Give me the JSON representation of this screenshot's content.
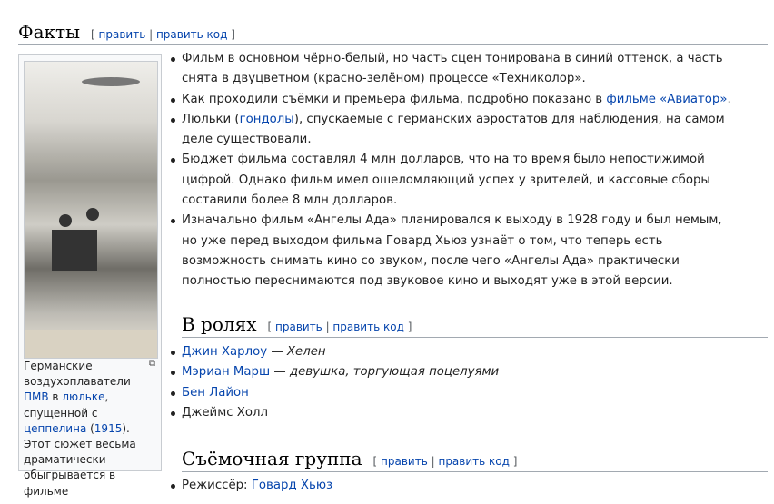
{
  "edit": {
    "edit": "править",
    "edit_code": "править код"
  },
  "facts": {
    "title": "Факты",
    "items": [
      {
        "text": "Фильм в основном чёрно-белый, но часть сцен тонирована в синий оттенок, а часть снята в двуцветном (красно-зелёном) процессе «Техниколор»."
      },
      {
        "pre": "Как проходили съёмки и премьера фильма, подробно показано в ",
        "link": "фильме «Авиатор»",
        "post": "."
      },
      {
        "pre": "Люльки (",
        "link": "гондолы",
        "post": "), спускаемые с германских аэростатов для наблюдения, на самом деле существовали."
      },
      {
        "text": "Бюджет фильма составлял 4 млн долларов, что на то время было непостижимой цифрой. Однако фильм имел ошеломляющий успех у зрителей, и кассовые сборы составили более 8 млн долларов."
      },
      {
        "text": "Изначально фильм «Ангелы Ада» планировался к выходу в 1928 году и был немым, но уже перед выходом фильма Говард Хьюз узнаёт о том, что теперь есть возможность снимать кино со звуком, после чего «Ангелы Ада» практически полностью переснимаются под звуковое кино и выходят уже в этой версии."
      }
    ]
  },
  "thumb": {
    "c1": "Германские воздухоплаватели ",
    "l1": "ПМВ",
    "c2": " в ",
    "l2": "люльке",
    "c3": ", спущенной с ",
    "l3": "цеппелина",
    "c4": " (",
    "l4": "1915",
    "c5": "). Этот сюжет весьма драматически обыгрывается в фильме"
  },
  "cast": {
    "title": "В ролях",
    "items": [
      {
        "actor": "Джин Харлоу",
        "role": "Хелен"
      },
      {
        "actor": "Мэриан Марш",
        "role": "девушка, торгующая поцелуями"
      },
      {
        "actor": "Бен Лайон",
        "role": ""
      },
      {
        "plain": "Джеймс Холл"
      }
    ]
  },
  "crew": {
    "title": "Съёмочная группа",
    "items": [
      {
        "label": "Режиссёр: ",
        "link": "Говард Хьюз"
      }
    ]
  }
}
